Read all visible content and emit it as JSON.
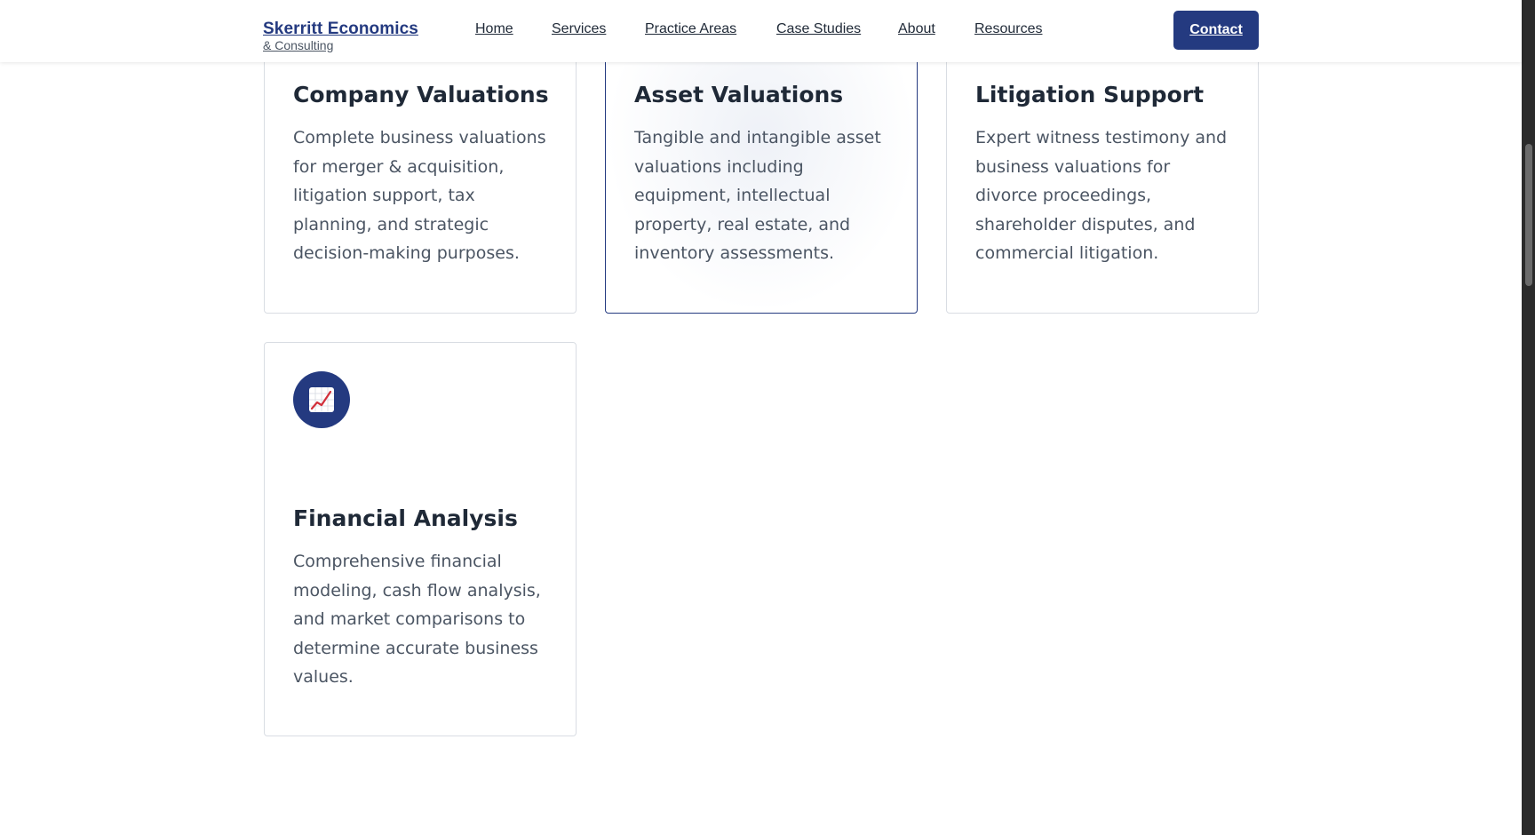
{
  "header": {
    "brand_name": "Skerritt Economics",
    "brand_sub": "& Consulting",
    "nav": [
      "Home",
      "Services",
      "Practice Areas",
      "Case Studies",
      "About",
      "Resources"
    ],
    "cta_label": "Contact"
  },
  "colors": {
    "brand": "#243a80",
    "text": "#1f2937",
    "muted_text": "#4b5563",
    "card_border": "#d9dde3"
  },
  "cards": [
    {
      "title": "Company Valuations",
      "description": "Complete business valuations for merger & acquisition, litigation support, tax planning, and strategic decision-making purposes."
    },
    {
      "title": "Asset Valuations",
      "description": "Tangible and intangible asset valuations including equipment, intellectual property, real estate, and inventory assessments."
    },
    {
      "title": "Litigation Support",
      "description": "Expert witness testimony and business valuations for divorce proceedings, shareholder disputes, and commercial litigation."
    },
    {
      "title": "Financial Analysis",
      "description": "Comprehensive financial modeling, cash flow analysis, and market comparisons to determine accurate business values.",
      "icon": "chart-increasing-icon"
    }
  ]
}
